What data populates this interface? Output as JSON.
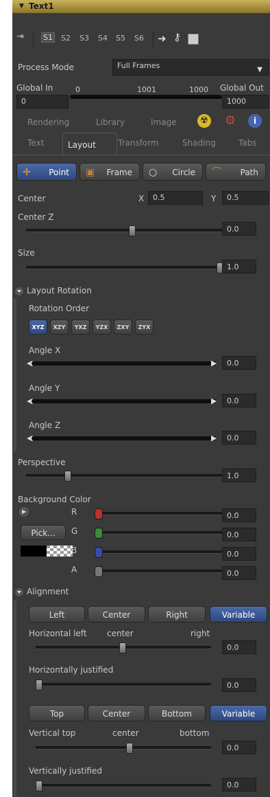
{
  "title": "Text1",
  "toolbar": {
    "tabs": [
      "S1",
      "S2",
      "S3",
      "S4",
      "S5",
      "S6"
    ]
  },
  "process_mode": {
    "label": "Process Mode",
    "value": "Full Frames"
  },
  "global": {
    "in_label": "Global In",
    "in_value": "0",
    "out_label": "Global Out",
    "out_value": "1000",
    "range_min": "0",
    "range_mid": "1001",
    "range_max": "1000"
  },
  "tabs_top": [
    "Rendering",
    "Library",
    "Image"
  ],
  "tabs_bottom": [
    "Text",
    "Layout",
    "Transform",
    "Shading",
    "Tabs"
  ],
  "layout_type": [
    "Point",
    "Frame",
    "Circle",
    "Path"
  ],
  "center": {
    "label": "Center",
    "x_label": "X",
    "x_value": "0.5",
    "y_label": "Y",
    "y_value": "0.5"
  },
  "center_z": {
    "label": "Center Z",
    "value": "0.0",
    "fraction": 0.5
  },
  "size": {
    "label": "Size",
    "value": "1.0",
    "fraction": 1.0
  },
  "layout_rotation": {
    "label": "Layout Rotation",
    "order_label": "Rotation Order",
    "orders": [
      "XYZ",
      "XZY",
      "YXZ",
      "YZX",
      "ZXY",
      "ZYX"
    ],
    "angles": [
      {
        "label": "Angle X",
        "value": "0.0"
      },
      {
        "label": "Angle Y",
        "value": "0.0"
      },
      {
        "label": "Angle Z",
        "value": "0.0"
      }
    ]
  },
  "perspective": {
    "label": "Perspective",
    "value": "1.0",
    "fraction": 0.2
  },
  "background_color": {
    "label": "Background Color",
    "pick_label": "Pick...",
    "channels": [
      {
        "name": "R",
        "value": "0.0",
        "color": "#b83030"
      },
      {
        "name": "G",
        "value": "0.0",
        "color": "#3a8a3a"
      },
      {
        "name": "B",
        "value": "0.0",
        "color": "#3a4aa8"
      },
      {
        "name": "A",
        "value": "0.0",
        "color": "#777777"
      }
    ]
  },
  "alignment": {
    "label": "Alignment",
    "h_buttons": [
      "Left",
      "Center",
      "Right",
      "Variable"
    ],
    "h_left": "Horizontal left",
    "h_center": "center",
    "h_right": "right",
    "h_value": "0.0",
    "h_justified": "Horizontally justified",
    "h_justified_value": "0.0",
    "v_buttons": [
      "Top",
      "Center",
      "Bottom",
      "Variable"
    ],
    "v_top": "Vertical top",
    "v_center": "center",
    "v_bottom": "bottom",
    "v_value": "0.0",
    "v_justified": "Vertically justified",
    "v_justified_value": "0.0"
  }
}
